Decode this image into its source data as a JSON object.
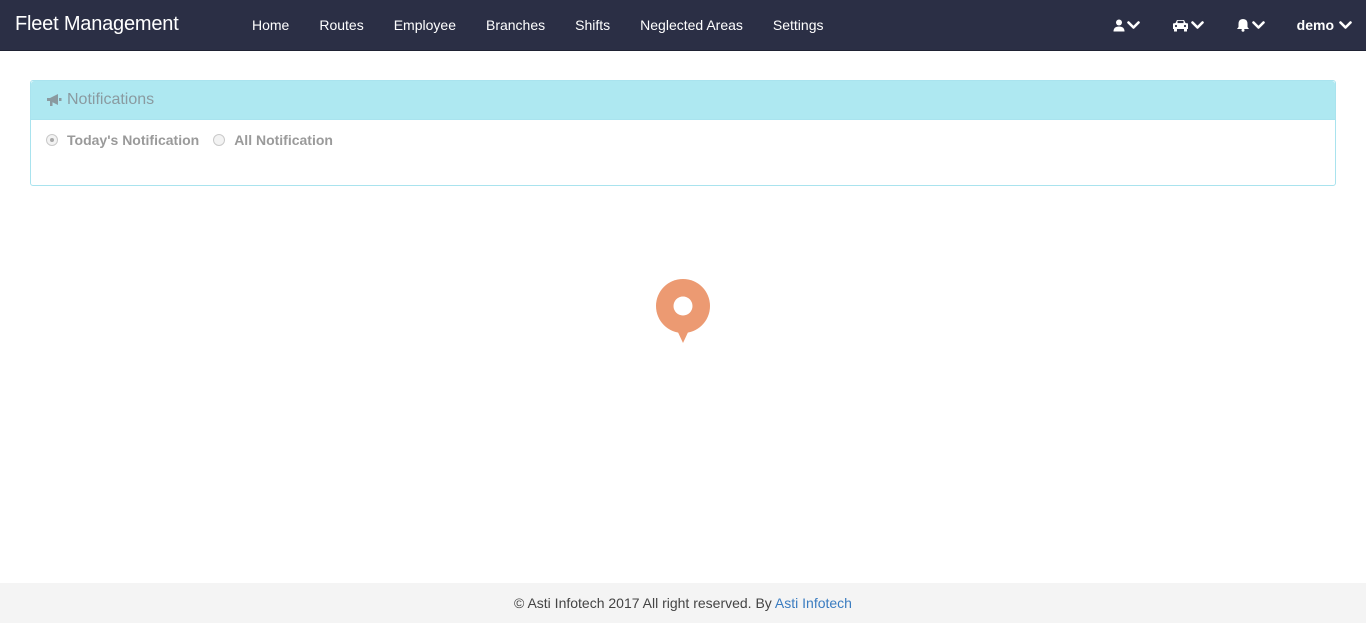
{
  "app": {
    "brand": "Fleet Management"
  },
  "nav": {
    "links": [
      "Home",
      "Routes",
      "Employee",
      "Branches",
      "Shifts",
      "Neglected Areas",
      "Settings"
    ],
    "user_name": "demo",
    "icons": [
      "user-icon",
      "car-icon",
      "bell-icon",
      "chevron-down-icon"
    ]
  },
  "notifications": {
    "title": "Notifications",
    "options": [
      {
        "label": "Today's Notification",
        "checked": true
      },
      {
        "label": "All Notification",
        "checked": false
      }
    ]
  },
  "footer": {
    "text": "© Asti Infotech 2017 All right reserved. By ",
    "link_text": "Asti Infotech"
  },
  "colors": {
    "navbar_bg": "#2b2f45",
    "panel_heading_bg": "#aee8f1",
    "loader_color": "#ec9a72",
    "footer_link": "#3a7cc0"
  }
}
